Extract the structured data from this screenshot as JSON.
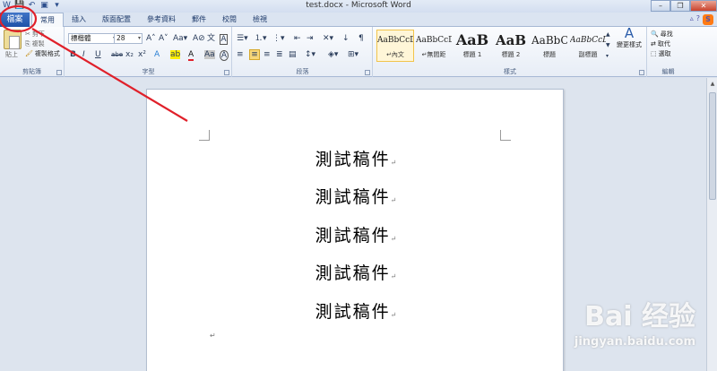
{
  "window": {
    "title": "test.docx - Microsoft Word",
    "quick_access": [
      "W",
      "💾",
      "↶",
      "▣",
      "▾"
    ],
    "controls": [
      "–",
      "❐",
      "✕"
    ]
  },
  "tabs": {
    "file": "檔案",
    "items": [
      "常用",
      "插入",
      "版面配置",
      "參考資料",
      "郵件",
      "校閱",
      "檢視"
    ],
    "active": "常用"
  },
  "ribbon": {
    "clipboard": {
      "label": "剪貼簿",
      "paste": "貼上",
      "cut": "剪下",
      "copy": "複製",
      "format_painter": "複製格式"
    },
    "font": {
      "label": "字型",
      "font_name": "標楷體",
      "font_size": "28",
      "buttons": [
        "B",
        "I",
        "U",
        "abe",
        "x₂",
        "x²",
        "A",
        "A",
        "Aa",
        "A"
      ]
    },
    "paragraph": {
      "label": "段落"
    },
    "styles": {
      "label": "樣式",
      "items": [
        {
          "sample": "AaBbCcD",
          "name": "↵內文",
          "selected": true
        },
        {
          "sample": "AaBbCcD",
          "name": "↵無間距",
          "selected": false
        },
        {
          "sample": "AaB",
          "name": "標題 1",
          "selected": false
        },
        {
          "sample": "AaB",
          "name": "標題 2",
          "selected": false
        },
        {
          "sample": "AaBbC",
          "name": "標題",
          "selected": false
        },
        {
          "sample": "AaBbCcD",
          "name": "副標題",
          "selected": false
        }
      ],
      "change_styles": "變更樣式"
    },
    "editing": {
      "label": "編輯",
      "find": "尋找",
      "replace": "取代",
      "select": "選取"
    }
  },
  "document": {
    "lines": [
      "測試稿件",
      "測試稿件",
      "測試稿件",
      "測試稿件",
      "測試稿件"
    ],
    "paragraph_mark": "↵"
  },
  "watermark": {
    "main": "Bai 经验",
    "sub": "jingyan.baidu.com"
  },
  "colors": {
    "file_tab": "#1e52a8",
    "annotation": "#e0202a",
    "selected_style": "#f2c44b"
  }
}
